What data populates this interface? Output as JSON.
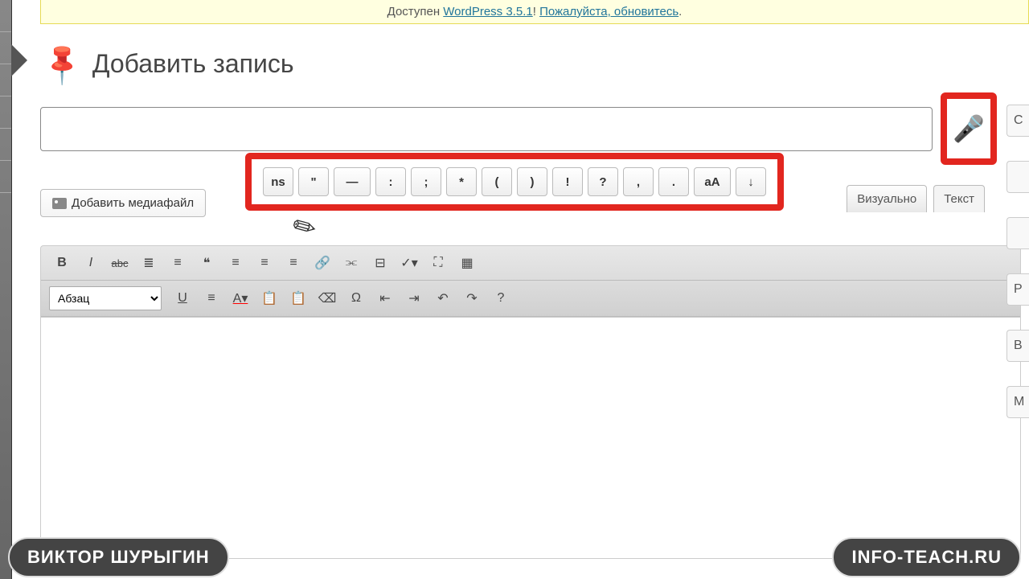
{
  "banner": {
    "prefix": "Доступен ",
    "link1": "WordPress 3.5.1",
    "mid": "! ",
    "link2": "Пожалуйста, обновитесь",
    "suffix": "."
  },
  "page": {
    "title": "Добавить запись",
    "title_placeholder": ""
  },
  "media_button": "Добавить медиафайл",
  "punct_buttons": [
    "ns",
    "\"",
    "—",
    ":",
    ";",
    "*",
    "(",
    ")",
    "!",
    "?",
    ",",
    ".",
    "аА",
    "↓"
  ],
  "tabs": {
    "visual": "Визуально",
    "text": "Текст"
  },
  "format_select": "Абзац",
  "toolbar_row1": [
    "B",
    "I",
    "abc",
    "ul",
    "ol",
    "“”",
    "al",
    "ac",
    "ar",
    "link",
    "unlink",
    "more",
    "spell",
    "fs",
    "kitchen"
  ],
  "toolbar_row2": [
    "U",
    "just",
    "A",
    "paste",
    "paste2",
    "erase",
    "Ω",
    "outd",
    "ind",
    "↶",
    "↷",
    "?"
  ],
  "side_stubs": [
    "С",
    "",
    "",
    "Р",
    "В",
    "М"
  ],
  "overlay": {
    "left": "ВИКТОР ШУРЫГИН",
    "right": "INFO-TEACH.RU"
  }
}
